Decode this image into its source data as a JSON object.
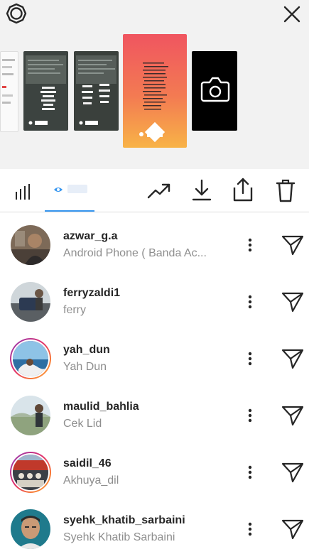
{
  "header": {
    "settings_icon": "settings-gear-icon",
    "close_icon": "close-icon"
  },
  "story_tray": {
    "camera_icon": "camera-icon"
  },
  "toolbar": {
    "icons": [
      "insights-bar-chart-icon",
      "viewers-eye-icon",
      "promote-trend-icon",
      "download-icon",
      "share-icon",
      "trash-icon"
    ],
    "accent_color": "#3897f0"
  },
  "viewers": [
    {
      "username": "azwar_g.a",
      "full_name": "Android Phone ( Banda Ac...",
      "story_ring": false
    },
    {
      "username": "ferryzaldi1",
      "full_name": "ferry",
      "story_ring": false
    },
    {
      "username": "yah_dun",
      "full_name": "Yah Dun",
      "story_ring": true
    },
    {
      "username": "maulid_bahlia",
      "full_name": "Cek Lid",
      "story_ring": false
    },
    {
      "username": "saidil_46",
      "full_name": "Akhuya_dil",
      "story_ring": true
    },
    {
      "username": "syehk_khatib_sarbaini",
      "full_name": "Syehk Khatib Sarbaini",
      "story_ring": false
    }
  ]
}
